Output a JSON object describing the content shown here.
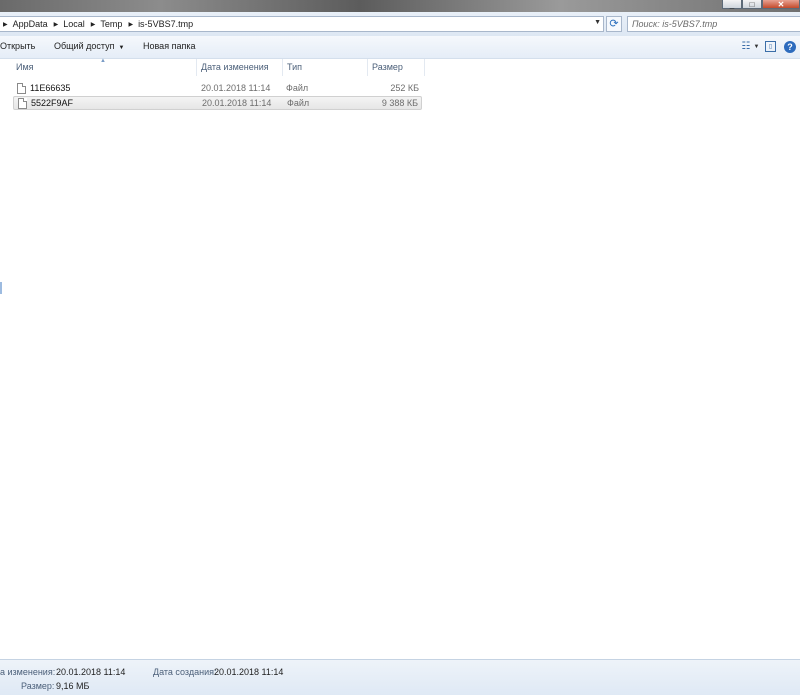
{
  "window": {
    "buttons": [
      "_",
      "□",
      "✕"
    ]
  },
  "breadcrumb": [
    "AppData",
    "Local",
    "Temp",
    "is-5VBS7.tmp"
  ],
  "search": {
    "placeholder": "Поиск: is-5VBS7.tmp"
  },
  "toolbar": {
    "open_label": "Открыть",
    "share_label": "Общий доступ",
    "new_folder_label": "Новая папка"
  },
  "icons": {
    "view": "view-options-icon",
    "preview": "preview-pane-icon",
    "help": "help-icon"
  },
  "columns": {
    "name": "Имя",
    "date": "Дата изменения",
    "type": "Тип",
    "size": "Размер"
  },
  "files": [
    {
      "name": "11E66635",
      "date": "20.01.2018 11:14",
      "type": "Файл",
      "size": "252 КБ",
      "selected": false
    },
    {
      "name": "5522F9AF",
      "date": "20.01.2018 11:14",
      "type": "Файл",
      "size": "9 388 КБ",
      "selected": true
    }
  ],
  "status": {
    "modified_label": "а изменения:",
    "modified_value": "20.01.2018 11:14",
    "created_label": "Дата создания:",
    "created_value": "20.01.2018 11:14",
    "size_label": "Размер:",
    "size_value": "9,16 МБ"
  }
}
